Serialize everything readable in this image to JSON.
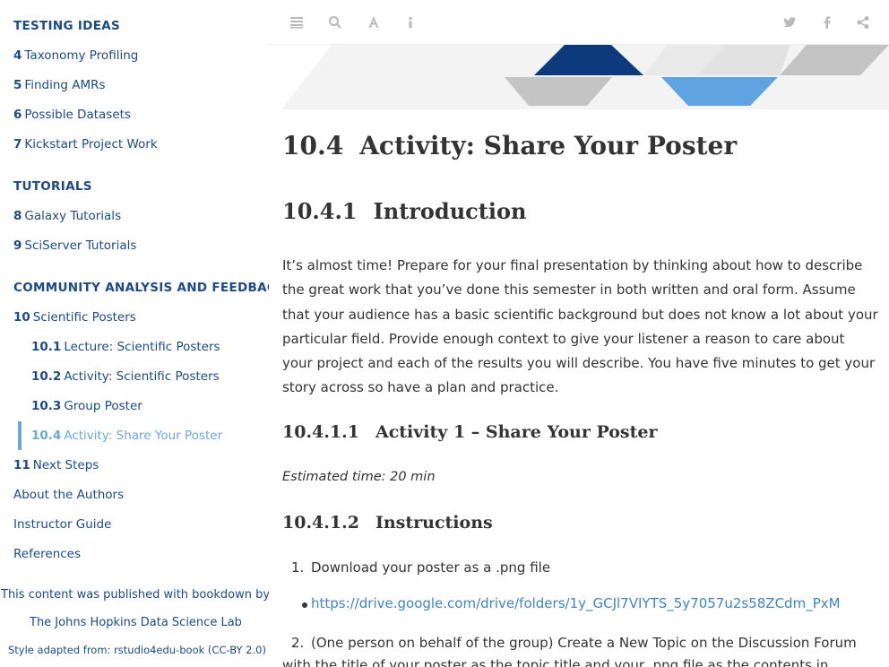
{
  "sidebar": {
    "sections": [
      {
        "heading": "TESTING IDEAS"
      },
      {
        "heading": "TUTORIALS"
      },
      {
        "heading": "COMMUNITY ANALYSIS AND FEEDBACK"
      }
    ],
    "items": [
      {
        "num": "4",
        "label": "Taxonomy Profiling"
      },
      {
        "num": "5",
        "label": "Finding AMRs"
      },
      {
        "num": "6",
        "label": "Possible Datasets"
      },
      {
        "num": "7",
        "label": "Kickstart Project Work"
      },
      {
        "num": "8",
        "label": "Galaxy Tutorials"
      },
      {
        "num": "9",
        "label": "SciServer Tutorials"
      },
      {
        "num": "10",
        "label": "Scientific Posters"
      },
      {
        "num": "10.1",
        "label": "Lecture: Scientific Posters"
      },
      {
        "num": "10.2",
        "label": "Activity: Scientific Posters"
      },
      {
        "num": "10.3",
        "label": "Group Poster"
      },
      {
        "num": "10.4",
        "label": "Activity: Share Your Poster"
      },
      {
        "num": "11",
        "label": "Next Steps"
      },
      {
        "num": "",
        "label": "About the Authors"
      },
      {
        "num": "",
        "label": "Instructor Guide"
      },
      {
        "num": "",
        "label": "References"
      }
    ],
    "footer": {
      "published": "This content was published with bookdown by:",
      "lab": "The Johns Hopkins Data Science Lab",
      "style": "Style adapted from: rstudio4edu-book (CC-BY 2.0)"
    }
  },
  "toolbar": {
    "left_icons": [
      "menu-icon",
      "search-icon",
      "font-icon",
      "info-icon"
    ],
    "right_icons": [
      "twitter-icon",
      "facebook-icon",
      "share-icon"
    ],
    "icon_color": "#b8b8b8"
  },
  "content": {
    "h1_num": "10.4",
    "h1_text": "Activity: Share Your Poster",
    "h2_num": "10.4.1",
    "h2_text": "Introduction",
    "intro": "It’s almost time! Prepare for your final presentation by thinking about how to describe the great work that you’ve done this semester in both written and oral form. Assume that your audience has a basic scientific background but does not know a lot about your particular field. Provide enough context to give your listener a reason to care about your project and each of the results you will describe. You have five minutes to get your story across so have a plan and practice.",
    "h3a_num": "10.4.1.1",
    "h3a_text": "Activity 1 – Share Your Poster",
    "estimated": "Estimated time: 20 min",
    "h3b_num": "10.4.1.2",
    "h3b_text": "Instructions",
    "step1_num": "1.",
    "step1": "Download your poster as a .png file",
    "link": "https://drive.google.com/drive/folders/1y_GCJl7VIYTS_5y7057u2s58ZCdm_PxM",
    "step2_num": "2.",
    "step2": "(One person on behalf of the group) Create a New Topic on the Discussion Forum with the title of your poster as the topic title and your .png file as the contents in"
  },
  "colors": {
    "nav": "#1b4a87",
    "active": "#6fa6d8",
    "link": "#4183c4",
    "banner_dark": "#0d3a7c",
    "banner_light": "#5fa3e0",
    "banner_gray": "#c4c4c4"
  }
}
